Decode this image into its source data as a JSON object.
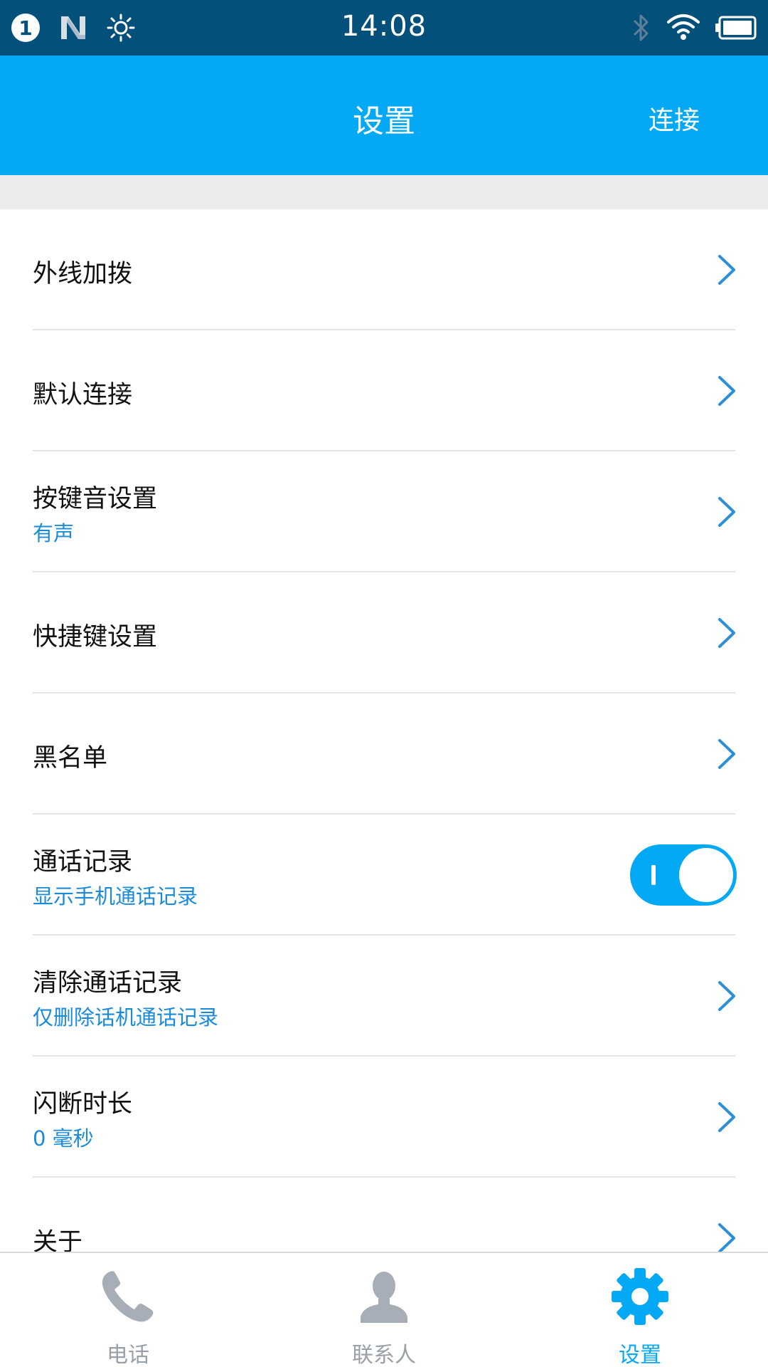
{
  "status_bar": {
    "notification_count": "1",
    "time": "14:08"
  },
  "header": {
    "title": "设置",
    "action_label": "连接"
  },
  "settings": [
    {
      "title": "外线加拨"
    },
    {
      "title": "默认连接"
    },
    {
      "title": "按键音设置",
      "subtitle": "有声"
    },
    {
      "title": "快捷键设置"
    },
    {
      "title": "黑名单"
    },
    {
      "title": "通话记录",
      "subtitle": "显示手机通话记录",
      "toggle_on": true
    },
    {
      "title": "清除通话记录",
      "subtitle": "仅删除话机通话记录"
    },
    {
      "title": "闪断时长",
      "subtitle": "0 毫秒"
    },
    {
      "title": "关于"
    }
  ],
  "bottom_nav": {
    "items": [
      {
        "label": "电话",
        "icon": "phone-icon"
      },
      {
        "label": "联系人",
        "icon": "person-icon"
      },
      {
        "label": "设置",
        "icon": "gear-icon",
        "active": true
      }
    ]
  },
  "colors": {
    "status_bar": "#03507b",
    "header": "#03a9f4",
    "accent": "#03a9f4",
    "subtitle": "#1a8bd9",
    "inactive_nav": "#9aa0a8"
  }
}
